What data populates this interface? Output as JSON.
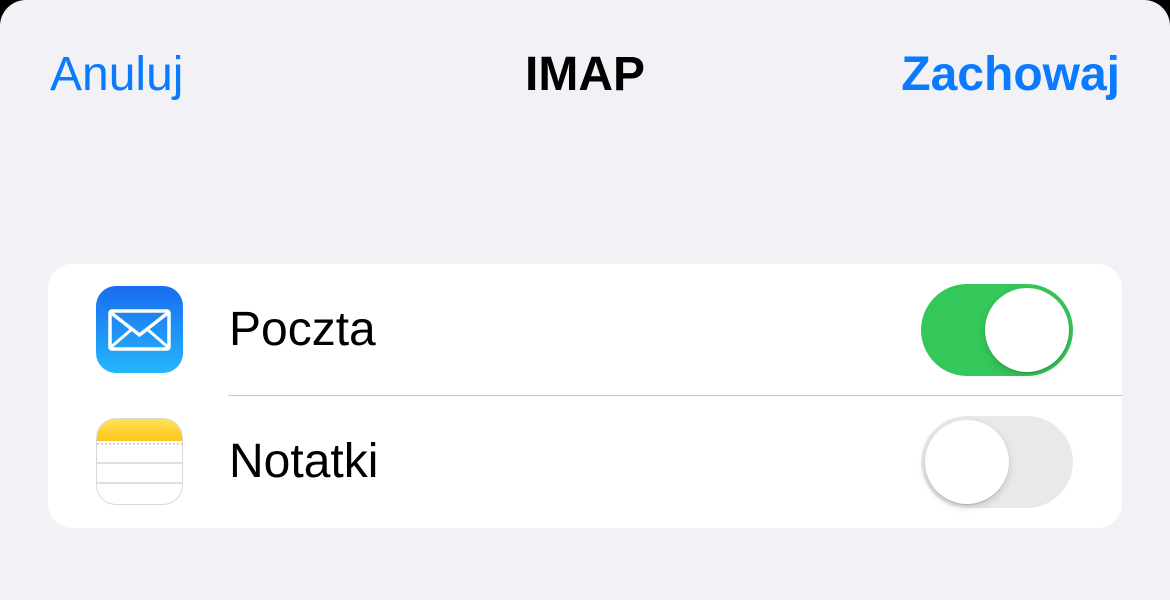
{
  "nav": {
    "cancel_label": "Anuluj",
    "title": "IMAP",
    "save_label": "Zachowaj"
  },
  "apps": [
    {
      "label": "Poczta",
      "icon": "mail-icon",
      "enabled": true
    },
    {
      "label": "Notatki",
      "icon": "notes-icon",
      "enabled": false
    }
  ],
  "colors": {
    "accent": "#0a7aff",
    "background": "#f2f1f6",
    "toggle_on": "#34c759",
    "toggle_off": "#e9e9ea"
  }
}
